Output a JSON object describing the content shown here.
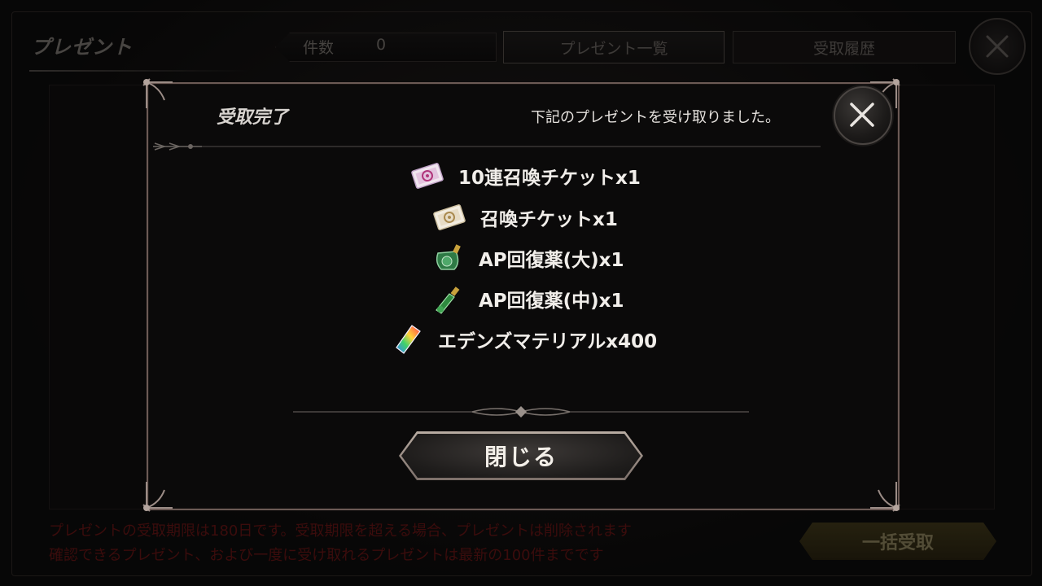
{
  "screen": {
    "title": "プレゼント",
    "count_label": "件数",
    "count_value": "0",
    "tabs": [
      {
        "label": "プレゼント一覧"
      },
      {
        "label": "受取履歴"
      }
    ],
    "notices": [
      "プレゼントの受取期限は180日です。受取期限を超える場合、プレゼントは削除されます",
      "確認できるプレゼント、および一度に受け取れるプレゼントは最新の100件までです"
    ],
    "bulk_receive_label": "一括受取"
  },
  "dialog": {
    "title": "受取完了",
    "message": "下記のプレゼントを受け取りました。",
    "items": [
      {
        "label": "10連召喚チケットx1",
        "icon": "ticket-10-icon"
      },
      {
        "label": "召喚チケットx1",
        "icon": "ticket-icon"
      },
      {
        "label": "AP回復薬(大)x1",
        "icon": "potion-large-icon"
      },
      {
        "label": "AP回復薬(中)x1",
        "icon": "potion-medium-icon"
      },
      {
        "label": "エデンズマテリアルx400",
        "icon": "crystal-icon"
      }
    ],
    "close_button_label": "閉じる"
  },
  "colors": {
    "dialog_border": "#6c5a55",
    "notice_text": "#5b1313",
    "bulk_button": "#3a3318"
  }
}
